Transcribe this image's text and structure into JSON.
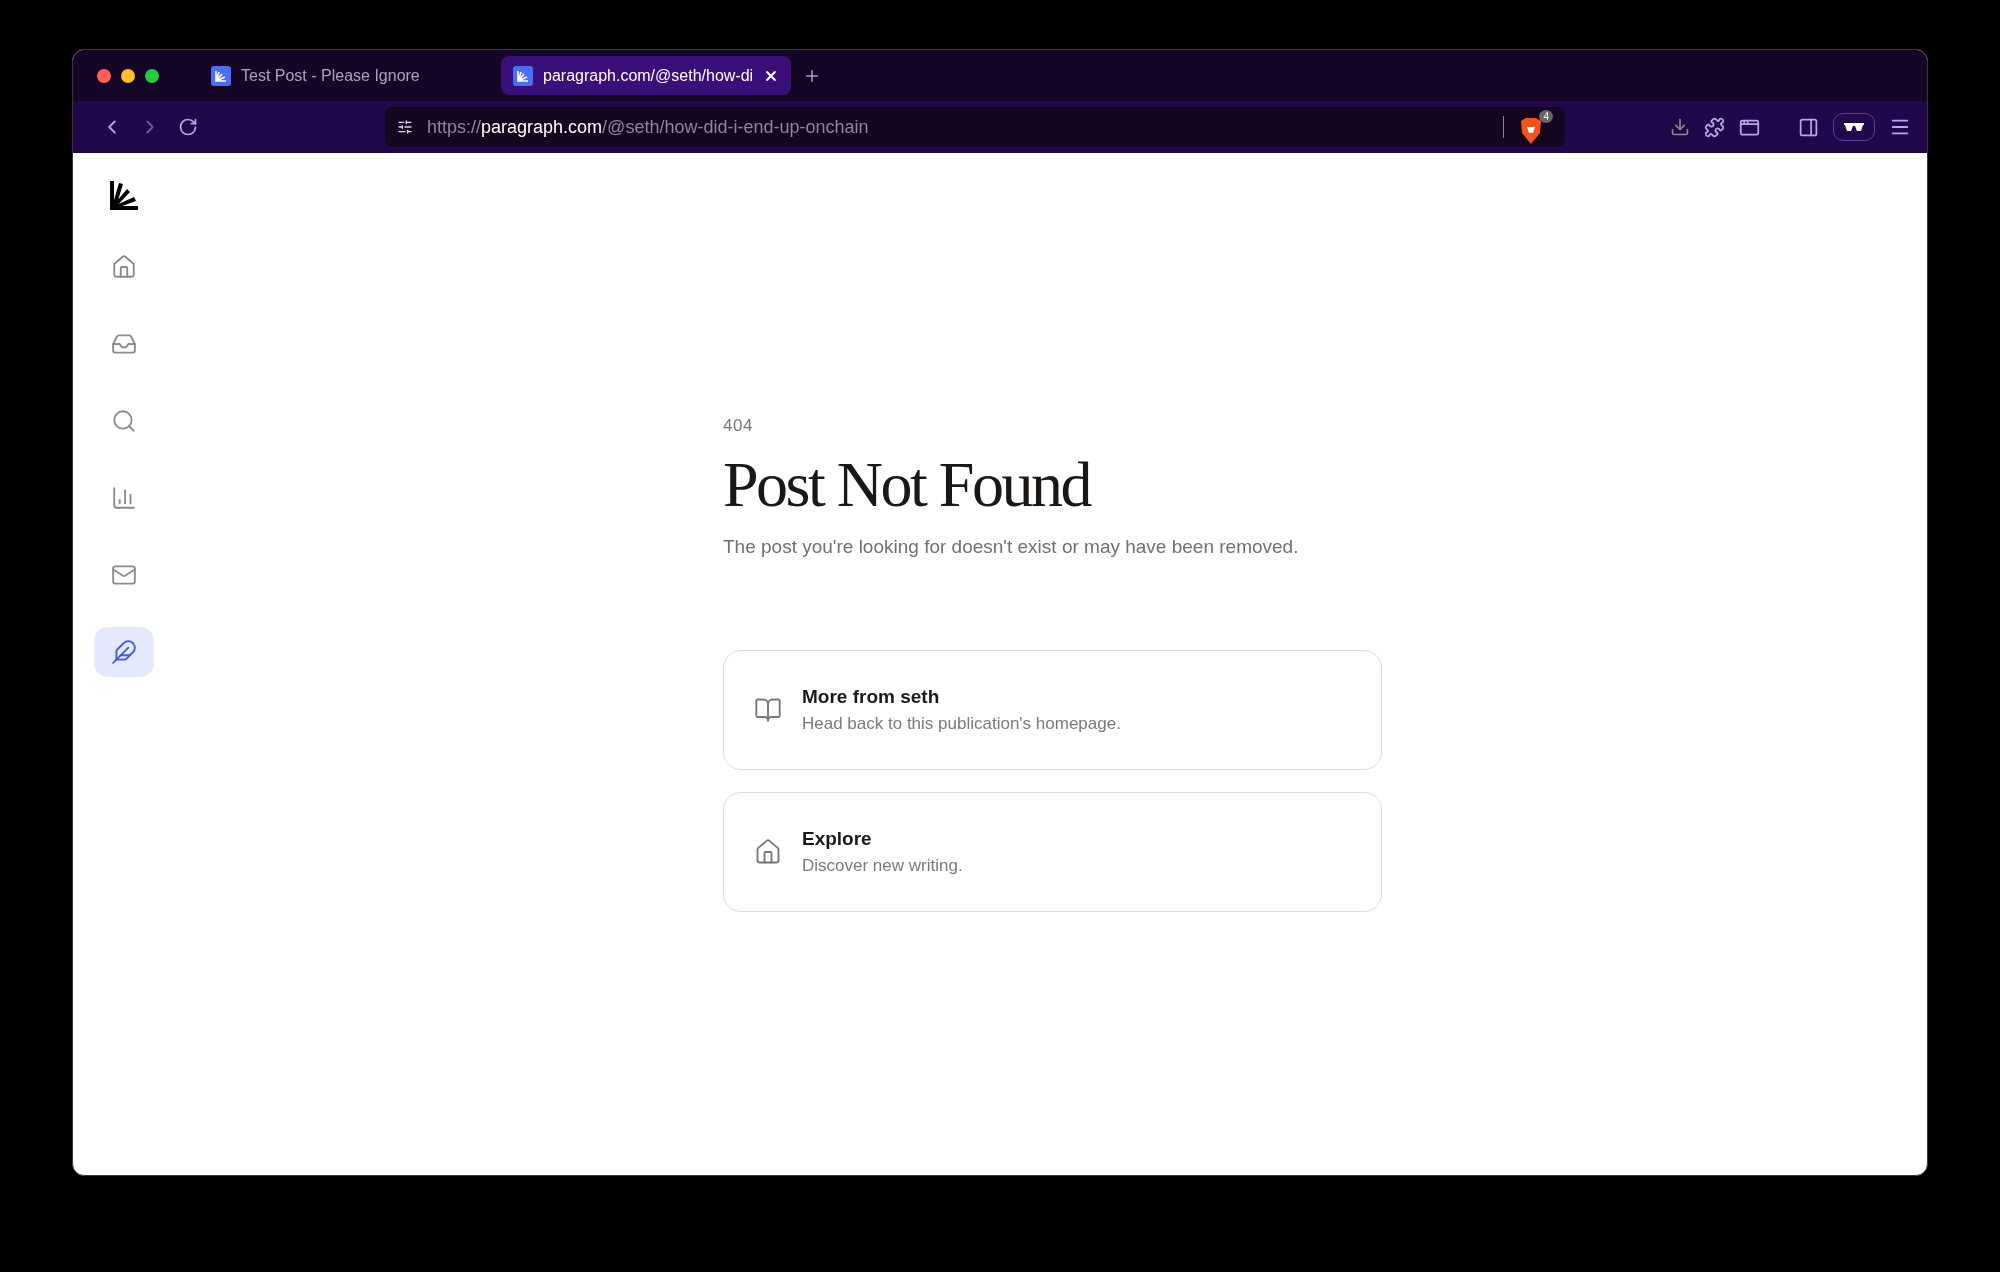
{
  "browser": {
    "tabs": [
      {
        "title": "Test Post - Please Ignore",
        "selected": false
      },
      {
        "title": "paragraph.com/@seth/how-di",
        "selected": true
      }
    ],
    "address": {
      "scheme": "https://",
      "host": "paragraph.com",
      "path": "/@seth/how-did-i-end-up-onchain"
    },
    "shields_count": "4"
  },
  "sidebar": {
    "items": [
      {
        "kind": "home",
        "selected": false
      },
      {
        "kind": "inbox",
        "selected": false
      },
      {
        "kind": "search",
        "selected": false
      },
      {
        "kind": "chart",
        "selected": false
      },
      {
        "kind": "mail",
        "selected": false
      },
      {
        "kind": "feather",
        "selected": true
      }
    ]
  },
  "error": {
    "code": "404",
    "title": "Post Not Found",
    "message": "The post you're looking for doesn't exist or may have been removed."
  },
  "links": [
    {
      "kind": "book",
      "title": "More from seth",
      "description": "Head back to this publication's homepage."
    },
    {
      "kind": "home",
      "title": "Explore",
      "description": "Discover new writing."
    }
  ]
}
